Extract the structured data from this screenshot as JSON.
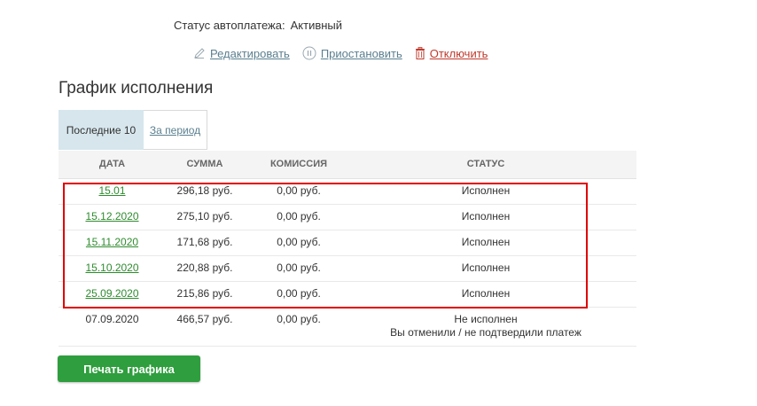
{
  "status": {
    "label": "Статус автоплатежа:",
    "value": "Активный"
  },
  "actions": {
    "edit": "Редактировать",
    "pause": "Приостановить",
    "disable": "Отключить"
  },
  "section_title": "График исполнения",
  "tabs": [
    {
      "label": "Последние 10"
    },
    {
      "label": "За период"
    }
  ],
  "table": {
    "headers": {
      "date": "ДАТА",
      "sum": "СУММА",
      "fee": "КОМИССИЯ",
      "status": "СТАТУС"
    },
    "rows": [
      {
        "date": "15.01",
        "sum": "296,18 руб.",
        "fee": "0,00 руб.",
        "status": "Исполнен",
        "link": true
      },
      {
        "date": "15.12.2020",
        "sum": "275,10 руб.",
        "fee": "0,00 руб.",
        "status": "Исполнен",
        "link": true
      },
      {
        "date": "15.11.2020",
        "sum": "171,68 руб.",
        "fee": "0,00 руб.",
        "status": "Исполнен",
        "link": true
      },
      {
        "date": "15.10.2020",
        "sum": "220,88 руб.",
        "fee": "0,00 руб.",
        "status": "Исполнен",
        "link": true
      },
      {
        "date": "25.09.2020",
        "sum": "215,86 руб.",
        "fee": "0,00 руб.",
        "status": "Исполнен",
        "link": true
      },
      {
        "date": "07.09.2020",
        "sum": "466,57 руб.",
        "fee": "0,00 руб.",
        "status": "Не исполнен",
        "status_note": "Вы отменили / не подтвердили платеж",
        "link": false
      }
    ]
  },
  "print_button": "Печать графика",
  "colors": {
    "link_green": "#2e8b2e",
    "link_blue": "#5a7f8f",
    "danger": "#c0392b",
    "button_green": "#2f9e3e",
    "highlight": "#e00000"
  }
}
